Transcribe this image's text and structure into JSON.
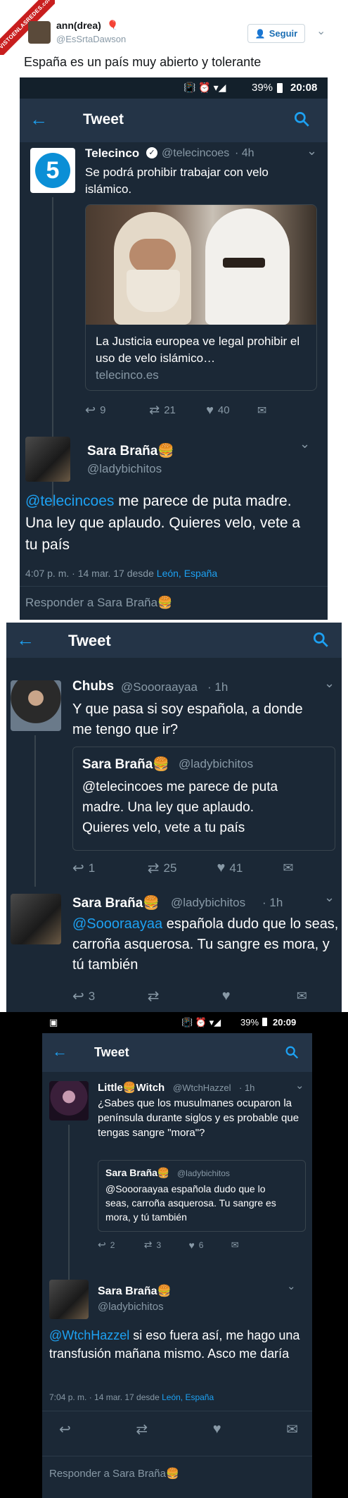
{
  "header": {
    "watermark": "VISTOENLASREDES.com",
    "author_name": "ann(drea)",
    "author_handle": "@EsSrtaDawson",
    "follow_label": "Seguir",
    "tweet_text": "España es un país muy abierto y tolerante"
  },
  "shot1": {
    "status": {
      "battery": "39%",
      "time": "20:08"
    },
    "app_title": "Tweet",
    "tweet1": {
      "name": "Telecinco",
      "handle": "@telecincoes",
      "age": "· 4h",
      "text": "Se podrá prohibir trabajar con velo islámico.",
      "card_title": "La Justicia europea ve legal prohibir el uso de velo islámico…",
      "card_domain": "telecinco.es",
      "replies": "9",
      "retweets": "21",
      "likes": "40"
    },
    "tweet2": {
      "name": "Sara Braña🍔",
      "handle": "@ladybichitos",
      "mention": "@telecincoes",
      "text": " me parece de puta madre. Una ley que aplaudo. Quieres velo, vete a tu país",
      "meta": "4:07 p. m. · 14 mar. 17  desde ",
      "location": "León, España"
    },
    "reply_placeholder": "Responder a Sara Braña🍔"
  },
  "shot2": {
    "app_title": "Tweet",
    "tweet1": {
      "name": "Chubs",
      "handle": "@Soooraayaa",
      "age": "· 1h",
      "text": "Y que pasa si soy española, a donde me tengo que ir?",
      "quote_name": "Sara Braña🍔",
      "quote_handle": "@ladybichitos",
      "quote_text": "@telecincoes me parece de puta madre. Una ley que aplaudo. Quieres velo, vete a tu país",
      "replies": "1",
      "retweets": "25",
      "likes": "41"
    },
    "tweet2": {
      "name": "Sara Braña🍔",
      "handle": "@ladybichitos",
      "age": "· 1h",
      "mention": "@Soooraayaa",
      "text": " española dudo que lo seas, carroña asquerosa. Tu sangre es mora, y tú también",
      "replies": "3"
    }
  },
  "shot3": {
    "status": {
      "battery": "39%",
      "time": "20:09"
    },
    "app_title": "Tweet",
    "tweet1": {
      "name": "Little🍔Witch",
      "handle": "@WtchHazzel",
      "age": "· 1h",
      "text": "¿Sabes que los musulmanes ocuparon la península durante siglos y es probable que tengas sangre \"mora\"?",
      "quote_name": "Sara Braña🍔",
      "quote_handle": "@ladybichitos",
      "quote_text": "@Soooraayaa española dudo que lo seas, carroña asquerosa. Tu sangre es mora, y tú también",
      "replies": "2",
      "retweets": "3",
      "likes": "6"
    },
    "tweet2": {
      "name": "Sara Braña🍔",
      "handle": "@ladybichitos",
      "mention": "@WtchHazzel",
      "text": " si eso fuera así, me hago una transfusión mañana mismo. Asco me daría",
      "meta": "7:04 p. m. · 14 mar. 17  desde ",
      "location": "León, España"
    },
    "reply_placeholder": "Responder a Sara Braña🍔"
  },
  "colors": {
    "accent": "#1da1f2",
    "dark_bg": "#1b2836",
    "telecinco": "#0b8fd6"
  }
}
